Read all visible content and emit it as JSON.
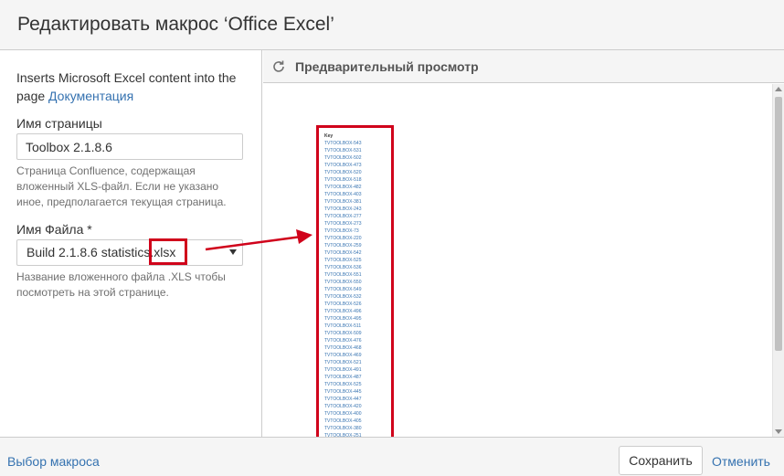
{
  "dialog": {
    "title": "Редактировать макрос ‘Office Excel’"
  },
  "left_panel": {
    "description": "Inserts Microsoft Excel content into the page",
    "doc_link": "Документация",
    "page_name": {
      "label": "Имя страницы",
      "value": "Toolbox 2.1.8.6",
      "help": "Страница Confluence, содержащая вложенный XLS-файл. Если не указано иное, предполагается текущая страница."
    },
    "file_name": {
      "label": "Имя Файла *",
      "value": "Build 2.1.8.6 statistics.xlsx",
      "help": "Название вложенного файла .XLS чтобы посмотреть на этой странице."
    }
  },
  "preview": {
    "title": "Предварительный просмотр",
    "refresh_icon": "refresh-icon",
    "sheet": {
      "header": "Key",
      "rows": [
        "TVTOOLBOX-543",
        "TVTOOLBOX-531",
        "TVTOOLBOX-502",
        "TVTOOLBOX-473",
        "TVTOOLBOX-520",
        "TVTOOLBOX-518",
        "TVTOOLBOX-482",
        "TVTOOLBOX-403",
        "TVTOOLBOX-381",
        "TVTOOLBOX-243",
        "TVTOOLBOX-277",
        "TVTOOLBOX-273",
        "TVTOOLBOX-73",
        "TVTOOLBOX-220",
        "TVTOOLBOX-259",
        "TVTOOLBOX-542",
        "TVTOOLBOX-525",
        "TVTOOLBOX-536",
        "TVTOOLBOX-551",
        "TVTOOLBOX-550",
        "TVTOOLBOX-549",
        "TVTOOLBOX-532",
        "TVTOOLBOX-526",
        "TVTOOLBOX-496",
        "TVTOOLBOX-495",
        "TVTOOLBOX-511",
        "TVTOOLBOX-509",
        "TVTOOLBOX-476",
        "TVTOOLBOX-468",
        "TVTOOLBOX-469",
        "TVTOOLBOX-521",
        "TVTOOLBOX-491",
        "TVTOOLBOX-487",
        "TVTOOLBOX-525",
        "TVTOOLBOX-445",
        "TVTOOLBOX-447",
        "TVTOOLBOX-420",
        "TVTOOLBOX-400",
        "TVTOOLBOX-405",
        "TVTOOLBOX-380",
        "TVTOOLBOX-251"
      ]
    }
  },
  "footer": {
    "select_macro": "Выбор макроса",
    "save": "Сохранить",
    "cancel": "Отменить"
  },
  "colors": {
    "link": "#3572b0",
    "annotation": "#d0021b",
    "panel_bg": "#f5f5f5",
    "border": "#cccccc"
  }
}
